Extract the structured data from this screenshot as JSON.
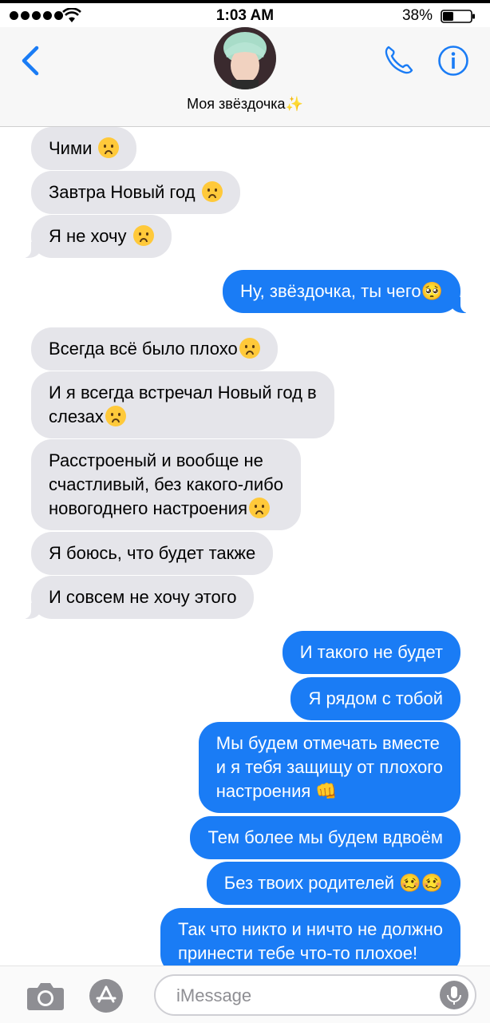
{
  "status_bar": {
    "time": "1:03 AM",
    "battery": "38%"
  },
  "header": {
    "contact_name": "Моя звёздочка✨"
  },
  "messages": [
    {
      "dir": "in",
      "text": "Чими "
    },
    {
      "dir": "in",
      "text": "Завтра Новый год "
    },
    {
      "dir": "in",
      "text": "Я не хочу "
    },
    {
      "dir": "out",
      "text": "Ну, звёздочка, ты чего🥺"
    },
    {
      "dir": "in",
      "text": "Всегда всё было плохо"
    },
    {
      "dir": "in",
      "text": "И я всегда встречал Новый год в\nслезах"
    },
    {
      "dir": "in",
      "text": "Расстроеный и вообще не\nсчастливый, без какого-либо\nновогоднего настроения"
    },
    {
      "dir": "in",
      "text": "Я боюсь, что будет также"
    },
    {
      "dir": "in",
      "text": "И совсем не хочу этого"
    },
    {
      "dir": "out",
      "text": "И такого не будет"
    },
    {
      "dir": "out",
      "text": "Я рядом с тобой"
    },
    {
      "dir": "out",
      "text": "Мы будем отмечать вместе\nи я тебя защищу от плохого\nнастроения 👊"
    },
    {
      "dir": "out",
      "text": "Тем более мы будем вдвоём"
    },
    {
      "dir": "out",
      "text": "Без твоих родителей 🥴🥴"
    },
    {
      "dir": "out",
      "text": "Так что никто и ничто не должно\nпринести тебе что-то плохое!"
    }
  ],
  "input": {
    "placeholder": "iMessage"
  },
  "colors": {
    "incoming": "#e5e5ea",
    "outgoing": "#1a7cf5",
    "accent": "#1a7cf5"
  },
  "icons": [
    "back-chevron-icon",
    "phone-icon",
    "info-icon",
    "camera-icon",
    "app-store-icon",
    "microphone-icon"
  ]
}
